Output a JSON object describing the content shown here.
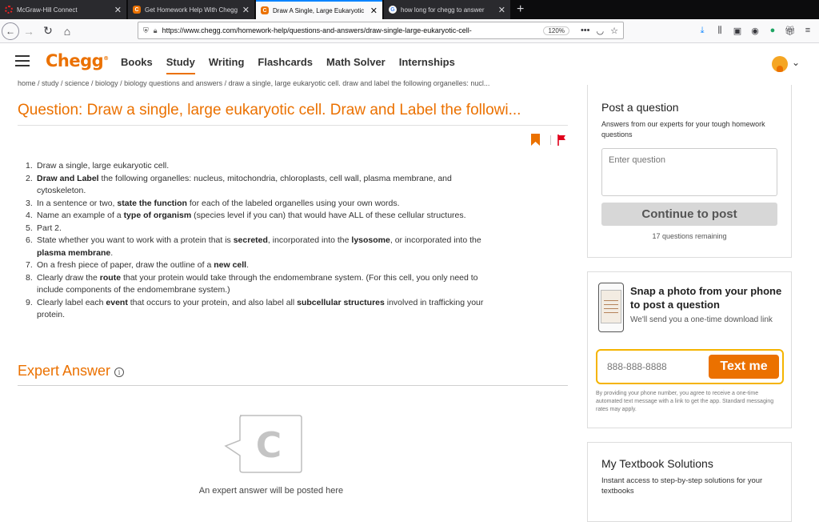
{
  "browser": {
    "tabs": [
      {
        "title": "McGraw-Hill Connect",
        "favicon": "mcgraw-hill-icon",
        "active": false
      },
      {
        "title": "Get Homework Help With Chegg",
        "favicon": "chegg-icon",
        "active": false
      },
      {
        "title": "Draw A Single, Large Eukaryotic",
        "favicon": "chegg-icon",
        "active": true
      },
      {
        "title": "how long for chegg to answer",
        "favicon": "google-icon",
        "active": false
      }
    ],
    "url_prefix": "https://www.",
    "url_domain": "chegg.com",
    "url_path": "/homework-help/questions-and-answers/draw-single-large-eukaryotic-cell-",
    "zoom": "120%"
  },
  "header": {
    "logo": "Chegg",
    "nav": [
      "Books",
      "Study",
      "Writing",
      "Flashcards",
      "Math Solver",
      "Internships"
    ],
    "active_nav": "Study"
  },
  "breadcrumb": "home / study / science / biology / biology questions and answers / draw a single, large eukaryotic cell. draw and label the following organelles: nucl...",
  "question": {
    "title": "Question: Draw a single, large eukaryotic cell.  Draw and Label the followi...",
    "items": [
      "Draw a single, large eukaryotic cell.",
      "<b>Draw and Label</b> the following organelles: nucleus, mitochondria, chloroplasts, cell wall, plasma membrane, and cytoskeleton.",
      "In a sentence or two, <b>state the function</b> for each of the labeled organelles using your own words.",
      "Name an example of a <b>type of organism</b> (species level if you can) that would have ALL of these cellular structures.",
      "Part 2.",
      "State whether you want to work with a protein that is <b>secreted</b>, incorporated into the <b>lysosome</b>, or incorporated into the <b>plasma membrane</b>.",
      "On a fresh piece of paper, draw the outline of a <b>new cell</b>.",
      "Clearly draw the <b>route</b> that your protein would take through the endomembrane system. (For this cell, you only need to include components of the endomembrane system.)",
      "Clearly label each <b>event</b> that occurs to your protein, and also label all <b>subcellular structures</b> involved in trafficking your protein."
    ]
  },
  "expert_answer": {
    "title": "Expert Answer",
    "placeholder_letter": "C",
    "pending_text": "An expert answer will be posted here"
  },
  "sidebar": {
    "post": {
      "title": "Post a question",
      "subtitle": "Answers from our experts for your tough homework questions",
      "input_placeholder": "Enter question",
      "button": "Continue to post",
      "remaining": "17 questions remaining"
    },
    "snap": {
      "title": "Snap a photo from your phone to post a question",
      "subtitle": "We'll send you a one-time download link",
      "phone_placeholder": "888-888-8888",
      "button": "Text me",
      "disclaimer": "By providing your phone number, you agree to receive a one-time automated text message with a link to get the app. Standard messaging rates may apply."
    },
    "textbook": {
      "title": "My Textbook Solutions",
      "subtitle": "Instant access to step-by-step solutions for your textbooks"
    }
  },
  "colors": {
    "brand_orange": "#eb7100",
    "flag_red": "#e0001b",
    "highlight_yellow": "#f5b400"
  }
}
